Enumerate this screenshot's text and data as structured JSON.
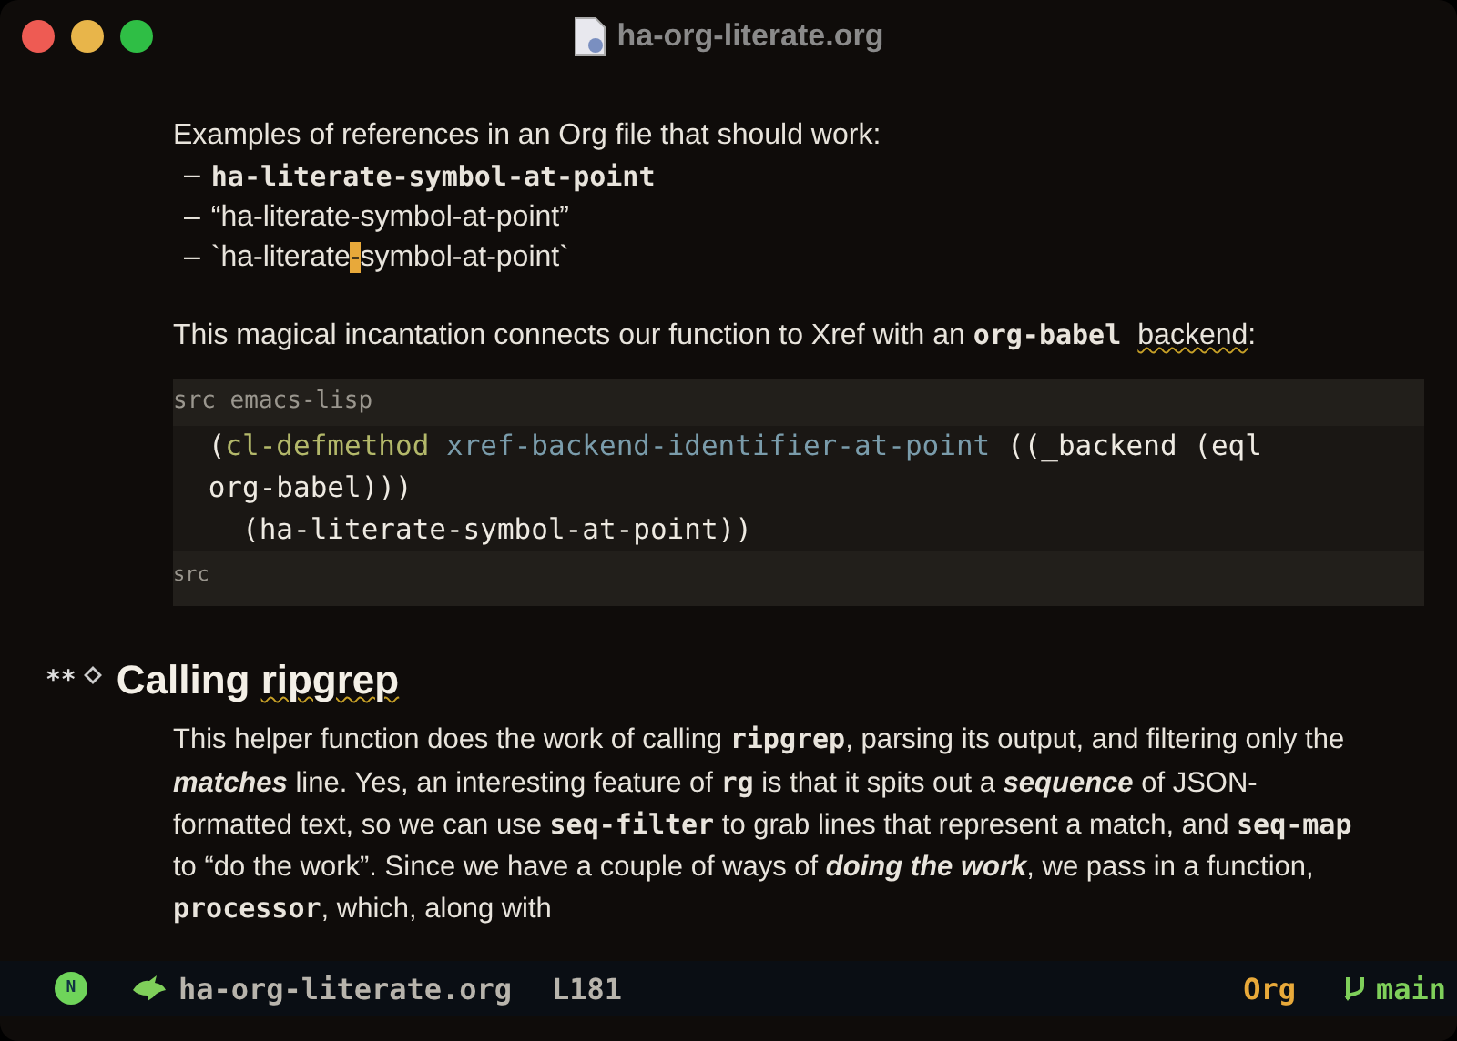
{
  "window": {
    "title": "ha-org-literate.org"
  },
  "intro": {
    "text": "Examples of references in an Org file that should work:",
    "items": [
      {
        "bullet": "–",
        "segments": [
          {
            "kind": "code",
            "text": "ha-literate-symbol-at-point"
          }
        ]
      },
      {
        "bullet": "–",
        "segments": [
          {
            "kind": "plain",
            "text": "“ha-literate-symbol-at-point”"
          }
        ]
      },
      {
        "bullet": "–",
        "segments": [
          {
            "kind": "plain",
            "text": "`ha-literate"
          },
          {
            "kind": "cursor",
            "text": "-"
          },
          {
            "kind": "plain",
            "text": "symbol-at-point`"
          }
        ]
      }
    ]
  },
  "paragraph": [
    {
      "kind": "plain",
      "text": "This magical incantation connects our function to Xref with an "
    },
    {
      "kind": "code",
      "text": "org-babel "
    },
    {
      "kind": "misspelled",
      "text": "backend"
    },
    {
      "kind": "plain",
      "text": ":"
    }
  ],
  "src_block": {
    "header": "src emacs-lisp",
    "footer": "src",
    "lines": [
      [
        {
          "kind": "plain",
          "text": " ("
        },
        {
          "kind": "keyword",
          "text": "cl-defmethod "
        },
        {
          "kind": "function",
          "text": "xref-backend-identifier-at-point"
        },
        {
          "kind": "plain",
          "text": " ((_backend (eql"
        }
      ],
      [
        {
          "kind": "plain",
          "text": " org-babel)))"
        }
      ],
      [
        {
          "kind": "plain",
          "text": "   (ha-literate-symbol-at-point))"
        }
      ]
    ]
  },
  "heading": {
    "stars": "**",
    "segments": [
      {
        "kind": "plain",
        "text": "Calling "
      },
      {
        "kind": "misspelled",
        "text": "ripgrep"
      }
    ]
  },
  "body": [
    {
      "kind": "plain",
      "text": "This helper function does the work of calling "
    },
    {
      "kind": "code",
      "text": "ripgrep"
    },
    {
      "kind": "plain",
      "text": ", parsing its output, and filtering only the "
    },
    {
      "kind": "italic",
      "text": "matches"
    },
    {
      "kind": "plain",
      "text": " line. Yes, an interesting feature of "
    },
    {
      "kind": "code",
      "text": "rg"
    },
    {
      "kind": "plain",
      "text": " is that it spits out a "
    },
    {
      "kind": "italic",
      "text": "sequence"
    },
    {
      "kind": "plain",
      "text": " of JSON-formatted text, so we can use "
    },
    {
      "kind": "code",
      "text": "seq-filter"
    },
    {
      "kind": "plain",
      "text": " to grab lines that represent a match, and "
    },
    {
      "kind": "code",
      "text": "seq-map"
    },
    {
      "kind": "plain",
      "text": " to “do the work”. Since we have a couple of ways of "
    },
    {
      "kind": "italic",
      "text": "doing the work"
    },
    {
      "kind": "plain",
      "text": ", we pass in a function, "
    },
    {
      "kind": "code",
      "text": "processor"
    },
    {
      "kind": "plain",
      "text": ", which, along with"
    }
  ],
  "mode_line": {
    "state": "N",
    "file": "ha-org-literate.org",
    "line": "L181",
    "mode": "Org",
    "branch": "main"
  }
}
